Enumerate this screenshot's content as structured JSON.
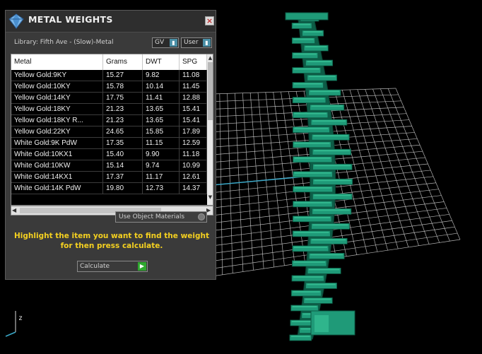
{
  "panel": {
    "title": "METAL WEIGHTS",
    "library": "Library: Fifth Ave - (Slow)-Metal",
    "gv_label": "GV",
    "user_label": "User",
    "use_object_materials": "Use Object Materials",
    "instructions": "Highlight the item you want to find the weight for then press calculate.",
    "calculate_label": "Calculate"
  },
  "table": {
    "columns": [
      "Metal",
      "Grams",
      "DWT",
      "SPG"
    ],
    "rows": [
      [
        "Yellow Gold:9KY",
        "15.27",
        "9.82",
        "11.08"
      ],
      [
        "Yellow Gold:10KY",
        "15.78",
        "10.14",
        "11.45"
      ],
      [
        "Yellow Gold:14KY",
        "17.75",
        "11.41",
        "12.88"
      ],
      [
        "Yellow Gold:18KY",
        "21.23",
        "13.65",
        "15.41"
      ],
      [
        "Yellow Gold:18KY R...",
        "21.23",
        "13.65",
        "15.41"
      ],
      [
        "Yellow Gold:22KY",
        "24.65",
        "15.85",
        "17.89"
      ],
      [
        "White Gold:9K PdW",
        "17.35",
        "11.15",
        "12.59"
      ],
      [
        "White Gold:10KX1",
        "15.40",
        "9.90",
        "11.18"
      ],
      [
        "White Gold:10KW",
        "15.14",
        "9.74",
        "10.99"
      ],
      [
        "White Gold:14KX1",
        "17.37",
        "11.17",
        "12.61"
      ],
      [
        "White Gold:14K PdW",
        "19.80",
        "12.73",
        "14.37"
      ]
    ]
  },
  "viewport": {
    "axis_label": "z",
    "model_color": "#1f9a78",
    "grid_color": "#cfcfcf"
  },
  "colors": {
    "instruction_text": "#f4d020",
    "panel_bg": "#3a3a3a"
  }
}
